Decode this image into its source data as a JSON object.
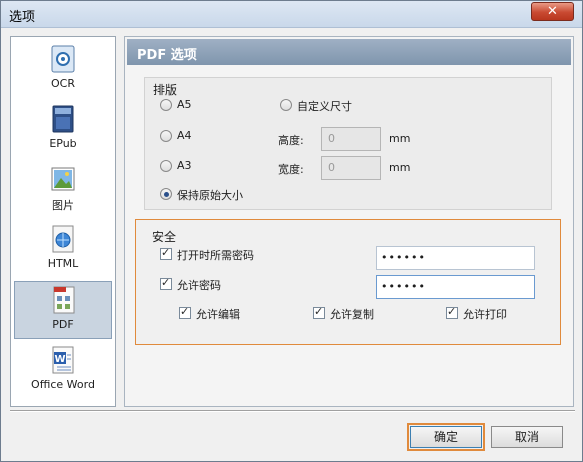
{
  "window": {
    "title": "选项",
    "close_label": "✕"
  },
  "sidebar": {
    "items": [
      {
        "label": "OCR",
        "icon": "ocr-icon"
      },
      {
        "label": "EPub",
        "icon": "epub-icon"
      },
      {
        "label": "图片",
        "icon": "image-icon"
      },
      {
        "label": "HTML",
        "icon": "html-icon"
      },
      {
        "label": "PDF",
        "icon": "pdf-icon",
        "selected": true
      },
      {
        "label": "Office Word",
        "icon": "word-icon"
      }
    ]
  },
  "panel": {
    "title": "PDF 选项",
    "layout": {
      "title": "排版",
      "options": {
        "a5": "A5",
        "a4": "A4",
        "a3": "A3",
        "original": "保持原始大小",
        "custom": "自定义尺寸"
      },
      "selected": "保持原始大小",
      "height_label": "高度:",
      "width_label": "宽度:",
      "height_value": "0",
      "width_value": "0",
      "unit": "mm"
    },
    "security": {
      "title": "安全",
      "open_password_label": "打开时所需密码",
      "open_password_checked": true,
      "open_password_value": "••••••",
      "permission_password_label": "允许密码",
      "permission_password_checked": true,
      "permission_password_value": "••••••",
      "allow_edit_label": "允许编辑",
      "allow_edit_checked": true,
      "allow_copy_label": "允许复制",
      "allow_copy_checked": true,
      "allow_print_label": "允许打印",
      "allow_print_checked": true
    }
  },
  "buttons": {
    "ok": "确定",
    "cancel": "取消"
  },
  "colors": {
    "accent_orange": "#e08a3c",
    "header_blue": "#8fa3ba",
    "selected_bg": "#c9d4e0"
  }
}
